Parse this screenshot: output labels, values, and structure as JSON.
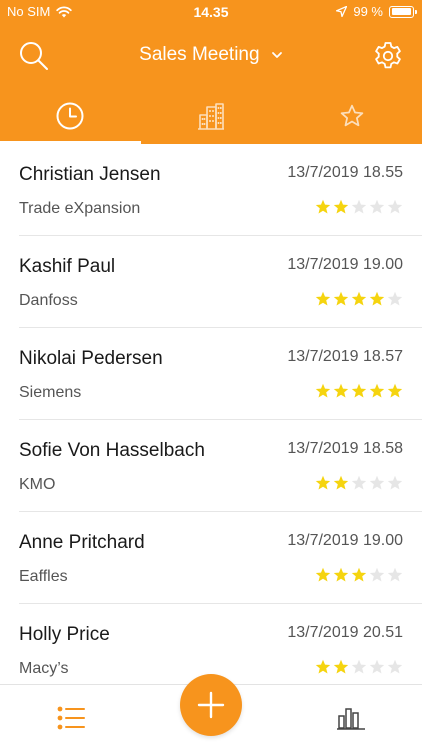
{
  "status_bar": {
    "carrier": "No SIM",
    "time": "14.35",
    "battery_percent": "99 %",
    "battery_level": 0.99
  },
  "nav": {
    "title": "Sales Meeting"
  },
  "tabs": [
    {
      "icon": "clock-icon",
      "active": true
    },
    {
      "icon": "buildings-icon",
      "active": false
    },
    {
      "icon": "star-outline-icon",
      "active": false
    }
  ],
  "meetings": [
    {
      "name": "Christian Jensen",
      "company": "Trade eXpansion",
      "datetime": "13/7/2019 18.55",
      "rating": 2
    },
    {
      "name": "Kashif Paul",
      "company": "Danfoss",
      "datetime": "13/7/2019 19.00",
      "rating": 4
    },
    {
      "name": "Nikolai Pedersen",
      "company": "Siemens",
      "datetime": "13/7/2019 18.57",
      "rating": 5
    },
    {
      "name": "Sofie Von Hasselbach",
      "company": "KMO",
      "datetime": "13/7/2019 18.58",
      "rating": 2
    },
    {
      "name": "Anne Pritchard",
      "company": "Eaffles",
      "datetime": "13/7/2019 19.00",
      "rating": 3
    },
    {
      "name": "Holly Price",
      "company": "Macy’s",
      "datetime": "13/7/2019 20.51",
      "rating": 2
    }
  ],
  "colors": {
    "accent": "#F7941D",
    "star_filled": "#F5D40F",
    "star_empty": "#E6E6E6"
  }
}
